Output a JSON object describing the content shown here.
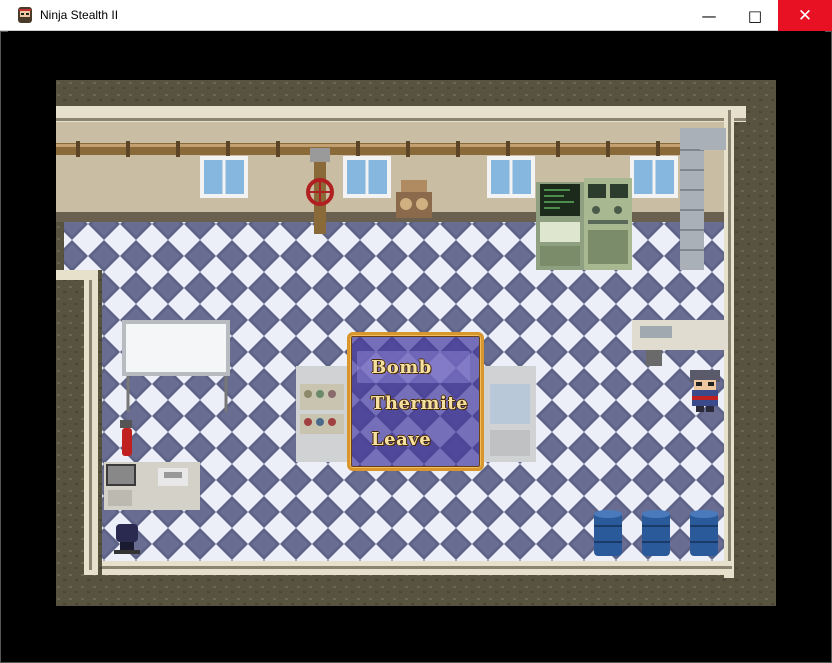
{
  "window": {
    "title": "Ninja Stealth II",
    "minimize_glyph": "—",
    "maximize_glyph": "□",
    "close_glyph": "✕",
    "app_icon": "ninja-face-icon"
  },
  "menu": {
    "options": [
      "Bomb",
      "Thermite",
      "Leave"
    ],
    "selected": "Bomb"
  },
  "colors": {
    "wall": "#c9bda4",
    "floor_light": "#eef0f8",
    "floor_dark": "#5e6488",
    "border_stone": "#5a5648",
    "menu_bg": "#463ca0",
    "menu_border": "#d8962c",
    "menu_text": "#f4e0a0"
  }
}
